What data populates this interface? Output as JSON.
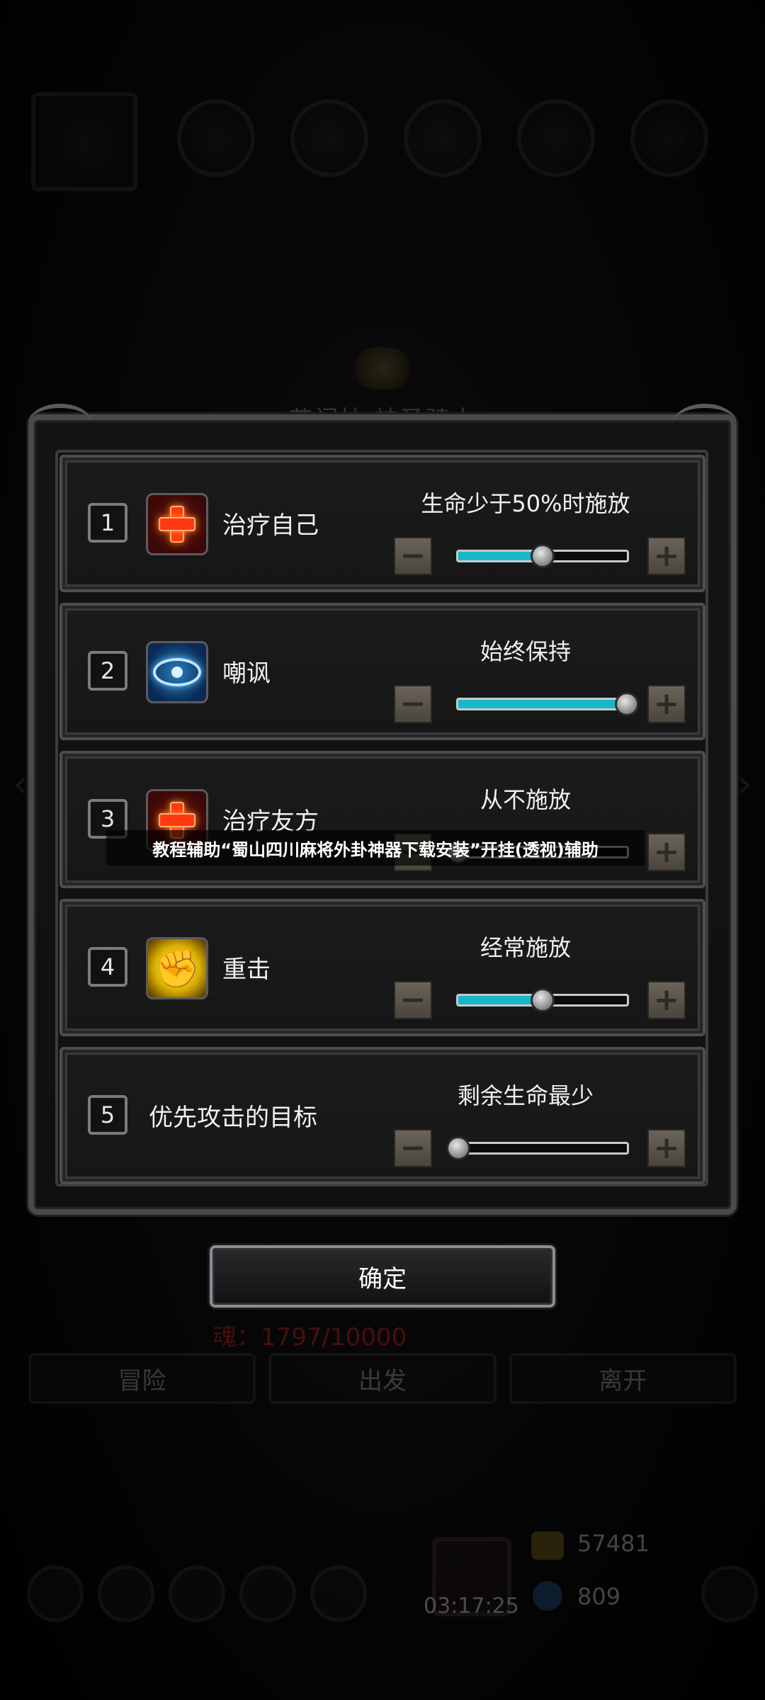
{
  "background": {
    "dialog_title": "艾门拉·神圣骑士",
    "soul_counter": "魂：1797/10000",
    "tabs": [
      "冒险",
      "出发",
      "离开"
    ],
    "timer": "03:17:25",
    "gold": "57481",
    "gems": "809"
  },
  "rows": [
    {
      "number": "1",
      "label": "治疗自己",
      "status": "生命少于50%时施放",
      "icon": "heal-cross-icon",
      "slider_fraction": 0.5
    },
    {
      "number": "2",
      "label": "嘲讽",
      "status": "始终保持",
      "icon": "eye-icon",
      "slider_fraction": 1.0
    },
    {
      "number": "3",
      "label": "治疗友方",
      "status": "从不施放",
      "icon": "heal-cross-icon",
      "slider_fraction": 0.0
    },
    {
      "number": "4",
      "label": "重击",
      "status": "经常施放",
      "icon": "fist-icon",
      "slider_fraction": 0.5
    },
    {
      "number": "5",
      "label": "优先攻击的目标",
      "status": "剩余生命最少",
      "icon": "",
      "slider_fraction": 0.0
    }
  ],
  "stepper": {
    "minus": "−",
    "plus": "+"
  },
  "confirm_label": "确定",
  "banner_text": "教程辅助“蜀山四川麻将外卦神器下载安装”开挂(透视)辅助",
  "colors": {
    "slider_fill": "#16b7c9",
    "heal_red": "#ff3a12",
    "taunt_blue": "#2a7fc0",
    "strike_yellow": "#d8b000"
  }
}
